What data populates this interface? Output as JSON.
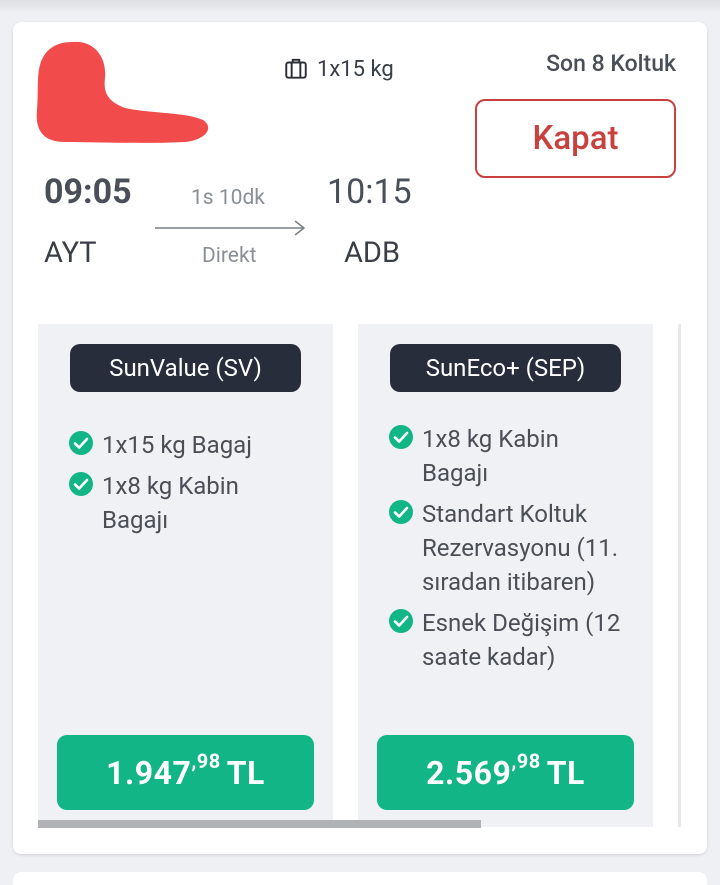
{
  "flight": {
    "baggage": "1x15 kg",
    "seats_left": "Son 8 Koltuk",
    "close_label": "Kapat",
    "departure_time": "09:05",
    "arrival_time": "10:15",
    "departure_airport": "AYT",
    "arrival_airport": "ADB",
    "duration": "1s 10dk",
    "flight_type": "Direkt"
  },
  "fares": [
    {
      "name": "SunValue (SV)",
      "features": [
        "1x15 kg Bagaj",
        "1x8 kg Kabin Bagajı"
      ],
      "price_main": "1.947",
      "price_cents": ",98",
      "currency": "TL"
    },
    {
      "name": "SunEco+ (SEP)",
      "features": [
        "1x8 kg Kabin Bagajı",
        "Standart Koltuk Rezervasyonu (11. sıradan itibaren)",
        "Esnek Değişim (12 saate kadar)"
      ],
      "price_main": "2.569",
      "price_cents": ",98",
      "currency": "TL"
    }
  ],
  "colors": {
    "brand_red": "#c9413f",
    "price_green": "#11b586",
    "badge_dark": "#272d3b",
    "redaction": "#f24b4b"
  },
  "icons": {
    "baggage": "suitcase-icon",
    "check": "check-circle-icon",
    "arrow": "arrow-right-icon"
  }
}
